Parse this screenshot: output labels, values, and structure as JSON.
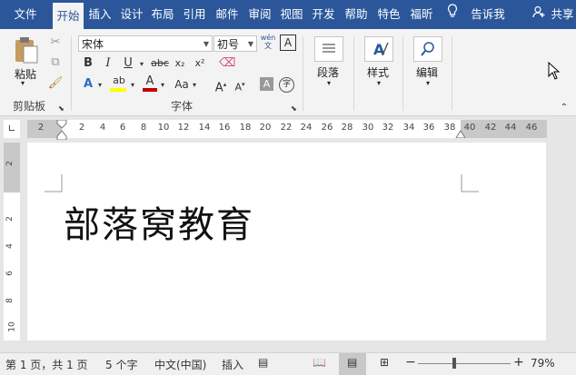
{
  "tabs": [
    "文件",
    "开始",
    "插入",
    "设计",
    "布局",
    "引用",
    "邮件",
    "审阅",
    "视图",
    "开发",
    "帮助",
    "特色",
    "福昕",
    "告诉我",
    "共享"
  ],
  "clipboard": {
    "paste": "粘贴",
    "group": "剪贴板"
  },
  "font": {
    "name": "宋体",
    "size": "初号",
    "group": "字体",
    "wen": "wén\n文"
  },
  "paragraph": {
    "label": "段落"
  },
  "styles": {
    "label": "样式"
  },
  "editing": {
    "label": "编辑"
  },
  "ruler_h": [
    "2",
    "2",
    "4",
    "6",
    "8",
    "10",
    "12",
    "14",
    "16",
    "18",
    "20",
    "22",
    "24",
    "26",
    "28",
    "30",
    "32",
    "34",
    "36",
    "38",
    "40",
    "42",
    "44",
    "46"
  ],
  "ruler_v": [
    "2",
    "2",
    "4",
    "6",
    "8",
    "10"
  ],
  "document": {
    "text": "部落窝教育"
  },
  "status": {
    "page": "第 1 页，共 1 页",
    "words": "5 个字",
    "lang": "中文(中国)",
    "mode": "插入",
    "zoom": "79%"
  },
  "colors": {
    "accent": "#2b579a",
    "highlight": "#ffff00",
    "font_color": "#c00000"
  }
}
